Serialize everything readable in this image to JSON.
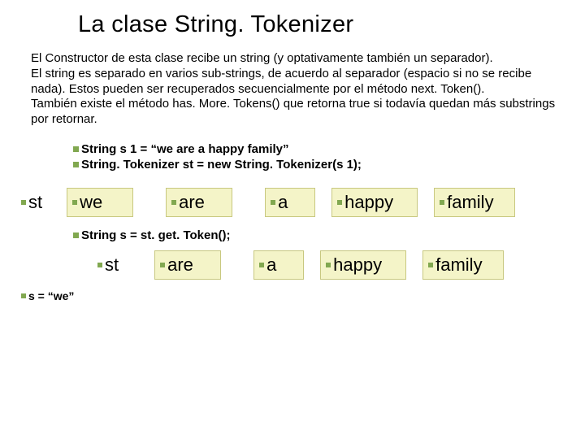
{
  "title": "La clase String. Tokenizer",
  "paragraph": "El Constructor de esta clase recibe un string (y optativamente también un separador).\nEl string es separado en varios sub-strings, de acuerdo al separador (espacio si no se recibe nada). Estos pueden ser recuperados secuencialmente por el método next. Token().\nTambién existe el método has. More. Tokens() que retorna true si todavía quedan más substrings por retornar.",
  "code": {
    "line1": "String s 1 = “we are a happy family”",
    "line2": "String. Tokenizer st = new String. Tokenizer(s 1);",
    "gettoken": "String s = st. get. Token();",
    "assign": "s = “we”"
  },
  "tokens": {
    "st_label": "st",
    "row1": [
      "we",
      "are",
      "a",
      "happy",
      "family"
    ],
    "row2_lead": "st",
    "row2": [
      "are",
      "a",
      "happy",
      "family"
    ]
  },
  "colors": {
    "bullet": "#81a850",
    "box_bg": "#f4f4c8",
    "box_border": "#c8c880"
  }
}
